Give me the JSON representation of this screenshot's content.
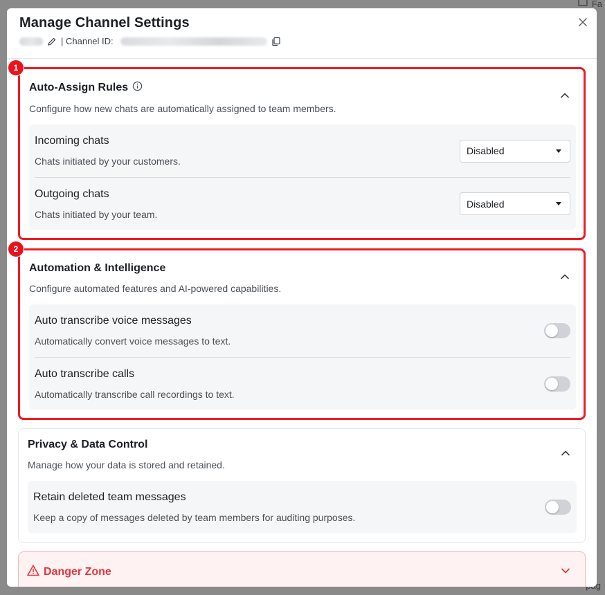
{
  "background": {
    "top_right_text": "Fa",
    "bottom_right_text": "pag"
  },
  "modal": {
    "title": "Manage Channel Settings",
    "channel_id_label": "| Channel ID:"
  },
  "sections": {
    "auto_assign": {
      "badge": "1",
      "title": "Auto-Assign Rules",
      "description": "Configure how new chats are automatically assigned to team members.",
      "rows": [
        {
          "title": "Incoming chats",
          "subtitle": "Chats initiated by your customers.",
          "value": "Disabled"
        },
        {
          "title": "Outgoing chats",
          "subtitle": "Chats initiated by your team.",
          "value": "Disabled"
        }
      ]
    },
    "automation": {
      "badge": "2",
      "title": "Automation & Intelligence",
      "description": "Configure automated features and AI-powered capabilities.",
      "rows": [
        {
          "title": "Auto transcribe voice messages",
          "subtitle": "Automatically convert voice messages to text.",
          "enabled": false
        },
        {
          "title": "Auto transcribe calls",
          "subtitle": "Automatically transcribe call recordings to text.",
          "enabled": false
        }
      ]
    },
    "privacy": {
      "title": "Privacy & Data Control",
      "description": "Manage how your data is stored and retained.",
      "rows": [
        {
          "title": "Retain deleted team messages",
          "subtitle": "Keep a copy of messages deleted by team members for auditing purposes.",
          "enabled": false
        }
      ]
    },
    "danger": {
      "title": "Danger Zone"
    }
  },
  "colors": {
    "highlight": "#ee1c25",
    "danger": "#e8333b",
    "panel": "#f5f6f8"
  },
  "icons": [
    "pencil-icon",
    "copy-icon",
    "close-icon",
    "info-icon",
    "chevron-up-icon",
    "chevron-down-icon",
    "warning-icon",
    "caret-down-icon"
  ]
}
